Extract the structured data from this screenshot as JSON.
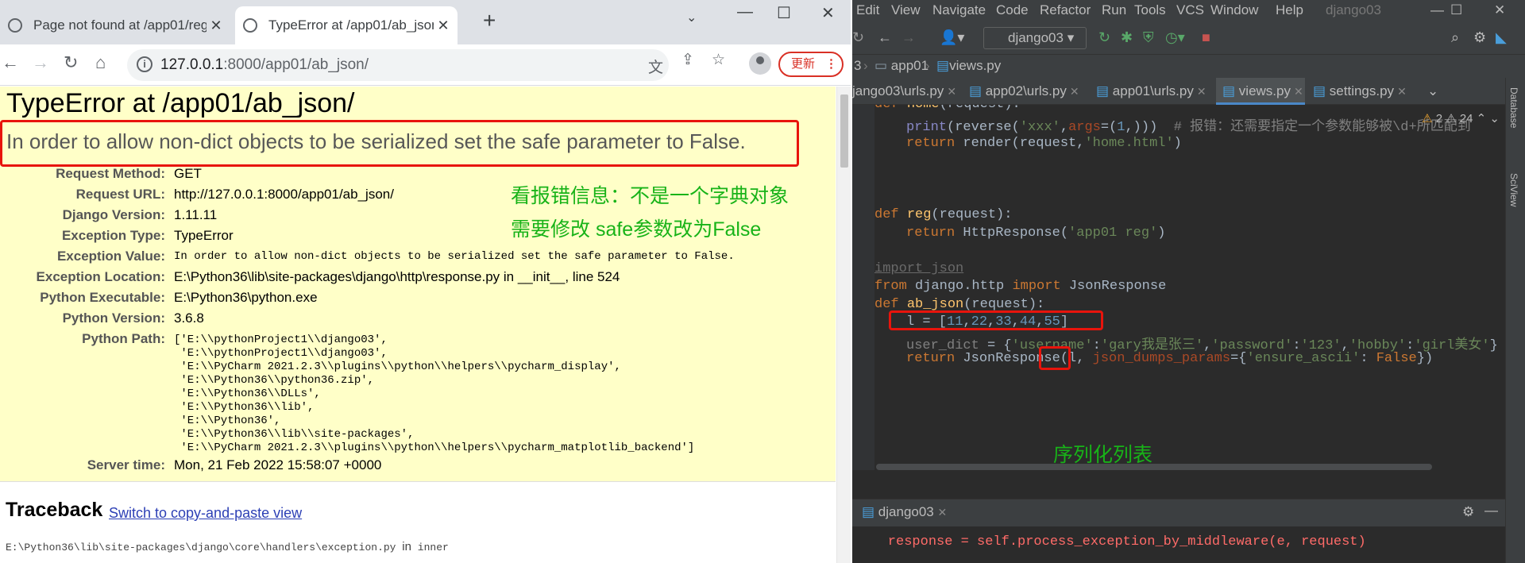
{
  "browser": {
    "tabs": [
      {
        "title": "Page not found at /app01/reg"
      },
      {
        "title": "TypeError at /app01/ab_json/"
      }
    ],
    "new_tab_label": "+",
    "address": {
      "host": "127.0.0.1",
      "path": ":8000/app01/ab_json/"
    },
    "update_button": "更新"
  },
  "page": {
    "title": "TypeError at /app01/ab_json/",
    "exception_message": "In order to allow non-dict objects to be serialized set the safe parameter to False.",
    "meta": [
      {
        "key": "Request Method:",
        "value": "GET"
      },
      {
        "key": "Request URL:",
        "value": "http://127.0.0.1:8000/app01/ab_json/"
      },
      {
        "key": "Django Version:",
        "value": "1.11.11"
      },
      {
        "key": "Exception Type:",
        "value": "TypeError"
      },
      {
        "key": "Exception Value:",
        "value": "In order to allow non-dict objects to be serialized set the safe parameter to False."
      },
      {
        "key": "Exception Location:",
        "value": "E:\\Python36\\lib\\site-packages\\django\\http\\response.py in __init__, line 524"
      },
      {
        "key": "Python Executable:",
        "value": "E:\\Python36\\python.exe"
      },
      {
        "key": "Python Version:",
        "value": "3.6.8"
      },
      {
        "key": "Python Path:",
        "value": ""
      },
      {
        "key": "Server time:",
        "value": "Mon, 21 Feb 2022 15:58:07 +0000"
      }
    ],
    "python_path": "['E:\\\\pythonProject1\\\\django03',\n 'E:\\\\pythonProject1\\\\django03',\n 'E:\\\\PyCharm 2021.2.3\\\\plugins\\\\python\\\\helpers\\\\pycharm_display',\n 'E:\\\\Python36\\\\python36.zip',\n 'E:\\\\Python36\\\\DLLs',\n 'E:\\\\Python36\\\\lib',\n 'E:\\\\Python36',\n 'E:\\\\Python36\\\\lib\\\\site-packages',\n 'E:\\\\PyCharm 2021.2.3\\\\plugins\\\\python\\\\helpers\\\\pycharm_matplotlib_backend']",
    "annotation_line1": "看报错信息：不是一个字典对象",
    "annotation_line2": "需要修改 safe参数改为False",
    "traceback_title": "Traceback",
    "traceback_link": "Switch to copy-and-paste view",
    "traceback_file": "E:\\Python36\\lib\\site-packages\\django\\core\\handlers\\exception.py",
    "traceback_in": "in",
    "traceback_func": "inner"
  },
  "ide": {
    "menu": [
      "Edit",
      "View",
      "Navigate",
      "Code",
      "Refactor",
      "Run",
      "Tools",
      "VCS",
      "Window",
      "Help"
    ],
    "project_name": "django03",
    "run_config": "django03",
    "breadcrumb": {
      "prefix": "3",
      "folder": "app01",
      "file": "views.py"
    },
    "file_tabs": [
      "jango03\\urls.py",
      "app02\\urls.py",
      "app01\\urls.py",
      "views.py",
      "settings.py"
    ],
    "warnings": {
      "warn_count": "2",
      "weak_count": "24"
    },
    "annotation": "序列化列表",
    "run_tab": "django03",
    "run_output": "    response = self.process_exception_by_middleware(e, request)",
    "side_tools": [
      "Database",
      "SciView"
    ]
  }
}
